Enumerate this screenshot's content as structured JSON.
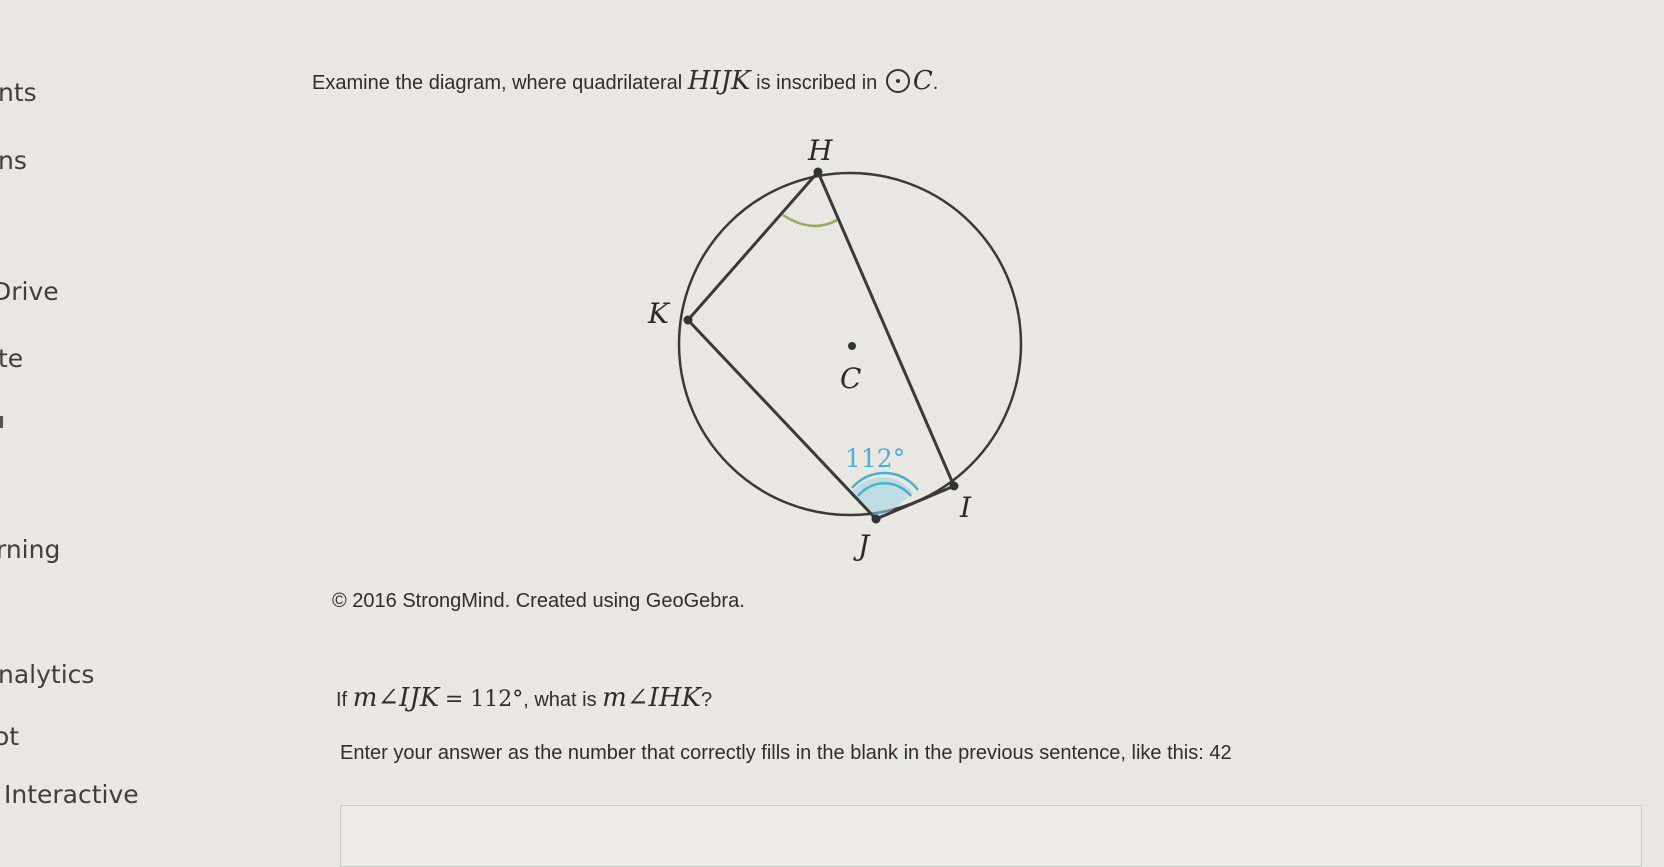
{
  "sidebar": {
    "items": [
      {
        "label": "nts"
      },
      {
        "label": "ns"
      },
      {
        "label": "Drive"
      },
      {
        "label": "te"
      },
      {
        "label": "rning"
      },
      {
        "label": "nalytics"
      },
      {
        "label": "ot"
      },
      {
        "label": "Interactive"
      }
    ]
  },
  "question": {
    "intro_text": "Examine the diagram, where quadrilateral",
    "intro_quad": "HIJK",
    "intro_mid": "is inscribed in",
    "intro_circle": "C",
    "intro_end": ".",
    "copyright": "© 2016 StrongMind. Created using GeoGebra.",
    "prompt_if": "If",
    "given_angle": "m∠IJK",
    "given_value": "= 112°",
    "prompt_mid": ", what is",
    "asked_angle": "m∠IHK",
    "prompt_end": "?",
    "instructions": "Enter your answer as the number that correctly fills in the blank in the previous sentence, like this: 42"
  },
  "diagram": {
    "points": {
      "H": "H",
      "I": "I",
      "J": "J",
      "K": "K",
      "C": "C"
    },
    "angle_label": "112°",
    "colors": {
      "line": "#3a3a3a",
      "angle_H": "#9aa86a",
      "angle_J": "#4bb1cf",
      "angle_J_fill": "#9fd3e3"
    }
  }
}
